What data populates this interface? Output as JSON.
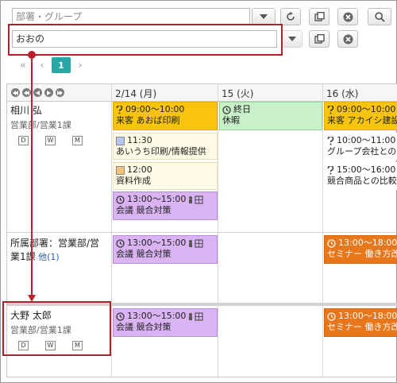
{
  "search": {
    "group_placeholder": "部署・グループ",
    "user_value": "おおの"
  },
  "pager": {
    "first": "«",
    "prev": "‹",
    "current": "1",
    "next": "›"
  },
  "days": [
    {
      "label": "2/14 (月)"
    },
    {
      "label": "15 (火)"
    },
    {
      "label": "16 (水)"
    }
  ],
  "rows": [
    {
      "name": "相川 弘",
      "dept": "営業部/営業1課",
      "dwm": [
        "D",
        "W",
        "M"
      ]
    },
    {
      "group_label": "所属部署：営業部/営業1課",
      "other_count": "他(1)"
    },
    {
      "name": "大野 太郎",
      "dept": "営業部/営業1課",
      "dwm": [
        "D",
        "W",
        "M"
      ]
    }
  ],
  "events": {
    "r1_d1_a": {
      "time": "09:00〜10:00",
      "title": "来客 あおば印刷"
    },
    "r1_d1_b": {
      "time": "11:30",
      "title": "あいうち印刷/情報提供"
    },
    "r1_d1_c": {
      "time": "12:00",
      "title": "資料作成"
    },
    "r1_d1_d": {
      "time": "13:00〜15:00",
      "title": "会議 競合対策"
    },
    "r1_d2_a": {
      "time": "終日",
      "title": "休暇"
    },
    "r1_d3_a": {
      "time": "09:00〜10:00",
      "title": "来客 アカイシ建設"
    },
    "r1_d3_b": {
      "time": "10:00〜11:00",
      "title": "グループ会社との会議"
    },
    "r1_d3_c": {
      "time": "15:00〜16:00",
      "title": "競合商品との比較"
    },
    "r2_d1_a": {
      "time": "13:00〜15:00",
      "title": "会議 競合対策"
    },
    "r2_d3_a": {
      "time": "13:00〜18:00",
      "title": "セミナー 働き方改革"
    },
    "r3_d1_a": {
      "time": "13:00〜15:00",
      "title": "会議 競合対策"
    },
    "r3_d3_a": {
      "time": "13:00〜18:00",
      "title": "セミナー 働き方改革"
    }
  }
}
